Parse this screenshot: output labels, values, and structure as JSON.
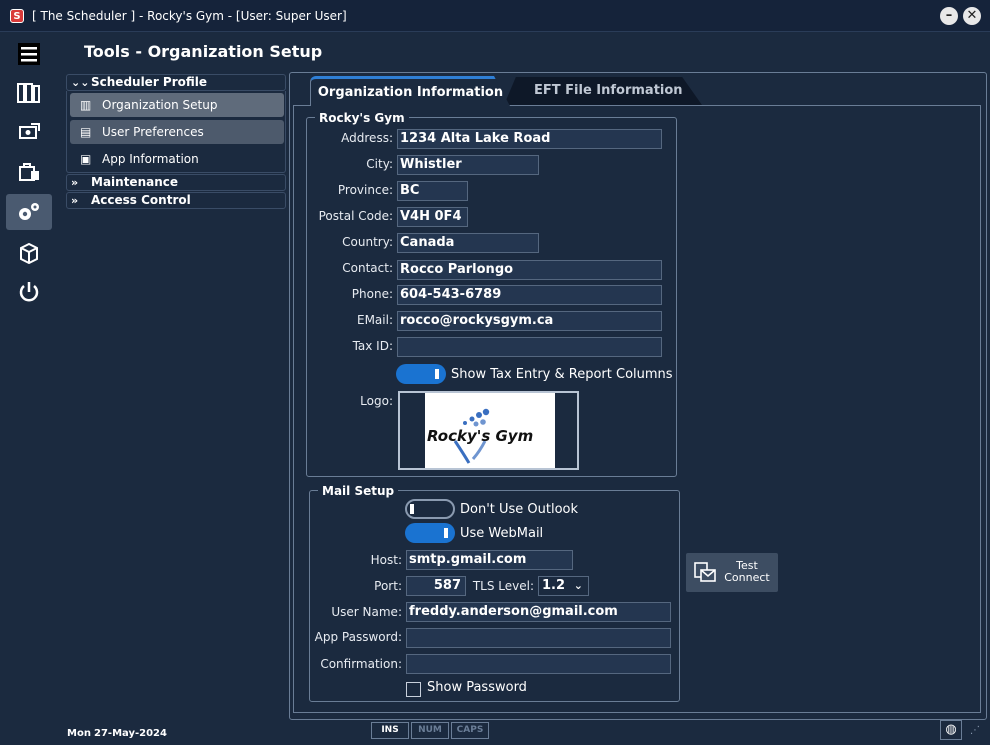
{
  "window": {
    "title": "[ The Scheduler ] - Rocky's Gym - [User: Super User]"
  },
  "page": {
    "title": "Tools - Organization Setup"
  },
  "nav": {
    "scheduler_profile": "Scheduler Profile",
    "items": [
      "Organization Setup",
      "User Preferences",
      "App Information"
    ],
    "maintenance": "Maintenance",
    "access_control": "Access Control"
  },
  "tabs": [
    "Organization Information",
    "EFT File Information"
  ],
  "org": {
    "group_title": "Rocky's Gym",
    "address_label": "Address:",
    "address": "1234 Alta Lake Road",
    "city_label": "City:",
    "city": "Whistler",
    "province_label": "Province:",
    "province": "BC",
    "postal_label": "Postal Code:",
    "postal": "V4H 0F4",
    "country_label": "Country:",
    "country": "Canada",
    "contact_label": "Contact:",
    "contact": "Rocco Parlongo",
    "phone_label": "Phone:",
    "phone": "604-543-6789",
    "email_label": "EMail:",
    "email": "rocco@rockysgym.ca",
    "taxid_label": "Tax ID:",
    "taxid": "",
    "tax_toggle_label": "Show Tax Entry & Report Columns",
    "logo_label": "Logo:",
    "logo_text": "Rocky's Gym"
  },
  "mail": {
    "group_title": "Mail Setup",
    "outlook_label": "Don't Use Outlook",
    "webmail_label": "Use WebMail",
    "host_label": "Host:",
    "host": "smtp.gmail.com",
    "port_label": "Port:",
    "port": "587",
    "tls_label": "TLS Level:",
    "tls": "1.2",
    "user_label": "User Name:",
    "user": "freddy.anderson@gmail.com",
    "app_pw_label": "App Password:",
    "confirm_label": "Confirmation:",
    "show_pw_label": "Show Password",
    "test_line1": "Test",
    "test_line2": "Connect"
  },
  "status": {
    "day": "Mon",
    "date": "27-May-2024",
    "ins": "INS",
    "num": "NUM",
    "caps": "CAPS"
  }
}
